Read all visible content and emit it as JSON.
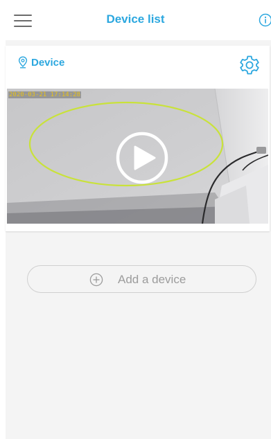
{
  "header": {
    "title": "Device list",
    "menu_icon": "hamburger-menu-icon",
    "info_icon": "info-circle-icon"
  },
  "device_card": {
    "device_name": "Device",
    "location_icon": "location-pin-icon",
    "settings_icon": "gear-icon",
    "video": {
      "timestamp": "2020-03-21  17:14:28",
      "play_icon": "play-icon"
    }
  },
  "add_device": {
    "label": "Add a device",
    "icon": "plus-circle-icon"
  },
  "colors": {
    "accent": "#2ba7df",
    "background": "#f4f4f4",
    "highlight_ellipse": "#c9e23a"
  }
}
